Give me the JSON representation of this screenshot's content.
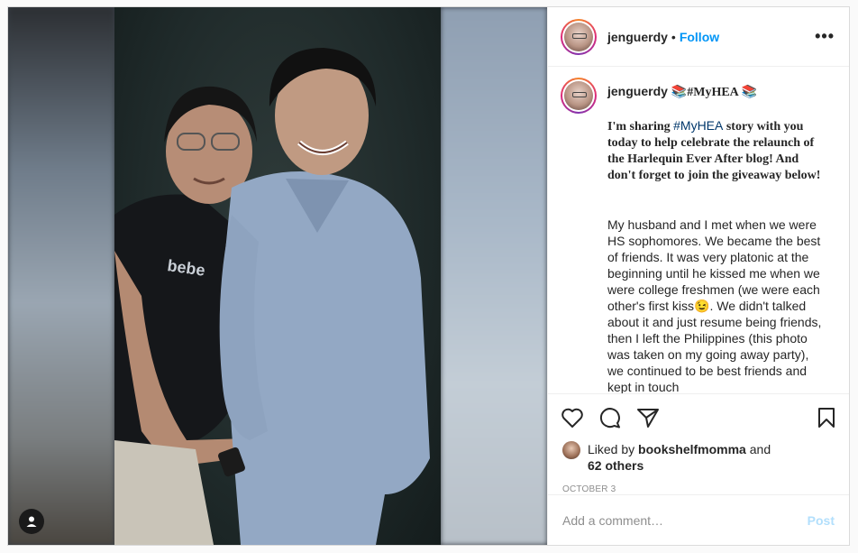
{
  "post": {
    "username": "jenguerdy",
    "follow_label": "Follow",
    "header_separator": "•",
    "more_label": "•••"
  },
  "caption": {
    "username": "jenguerdy",
    "title": "📚#MyHEA 📚",
    "intro_before": "I'm sharing ",
    "intro_hashtag": "#MyHEA",
    "intro_after": " story with you today to help celebrate the relaunch of the Harlequin Ever After blog! And don't forget to join the giveaway below!",
    "story": "My husband and I met when we were HS sophomores. We became the best of friends. It was very platonic at the beginning until he kissed me when we were college freshmen (we were each other's first kiss😉. We didn't talked about it and just resume being friends, then I left the Philippines (this photo was taken on my going away party), we continued to be best friends and kept in touch"
  },
  "likes": {
    "prefix": "Liked by ",
    "user": "bookshelfmomma",
    "middle": " and",
    "others": "62 others"
  },
  "date": "OCTOBER 3",
  "comment": {
    "placeholder": "Add a comment…",
    "post_label": "Post"
  },
  "icons": {
    "like": "heart-icon",
    "comment": "comment-icon",
    "share": "paper-plane-icon",
    "save": "bookmark-icon",
    "tagged": "user-tag-icon"
  },
  "colors": {
    "follow": "#0095f6",
    "post_disabled": "#b2dffc",
    "hashtag": "#00376b"
  }
}
